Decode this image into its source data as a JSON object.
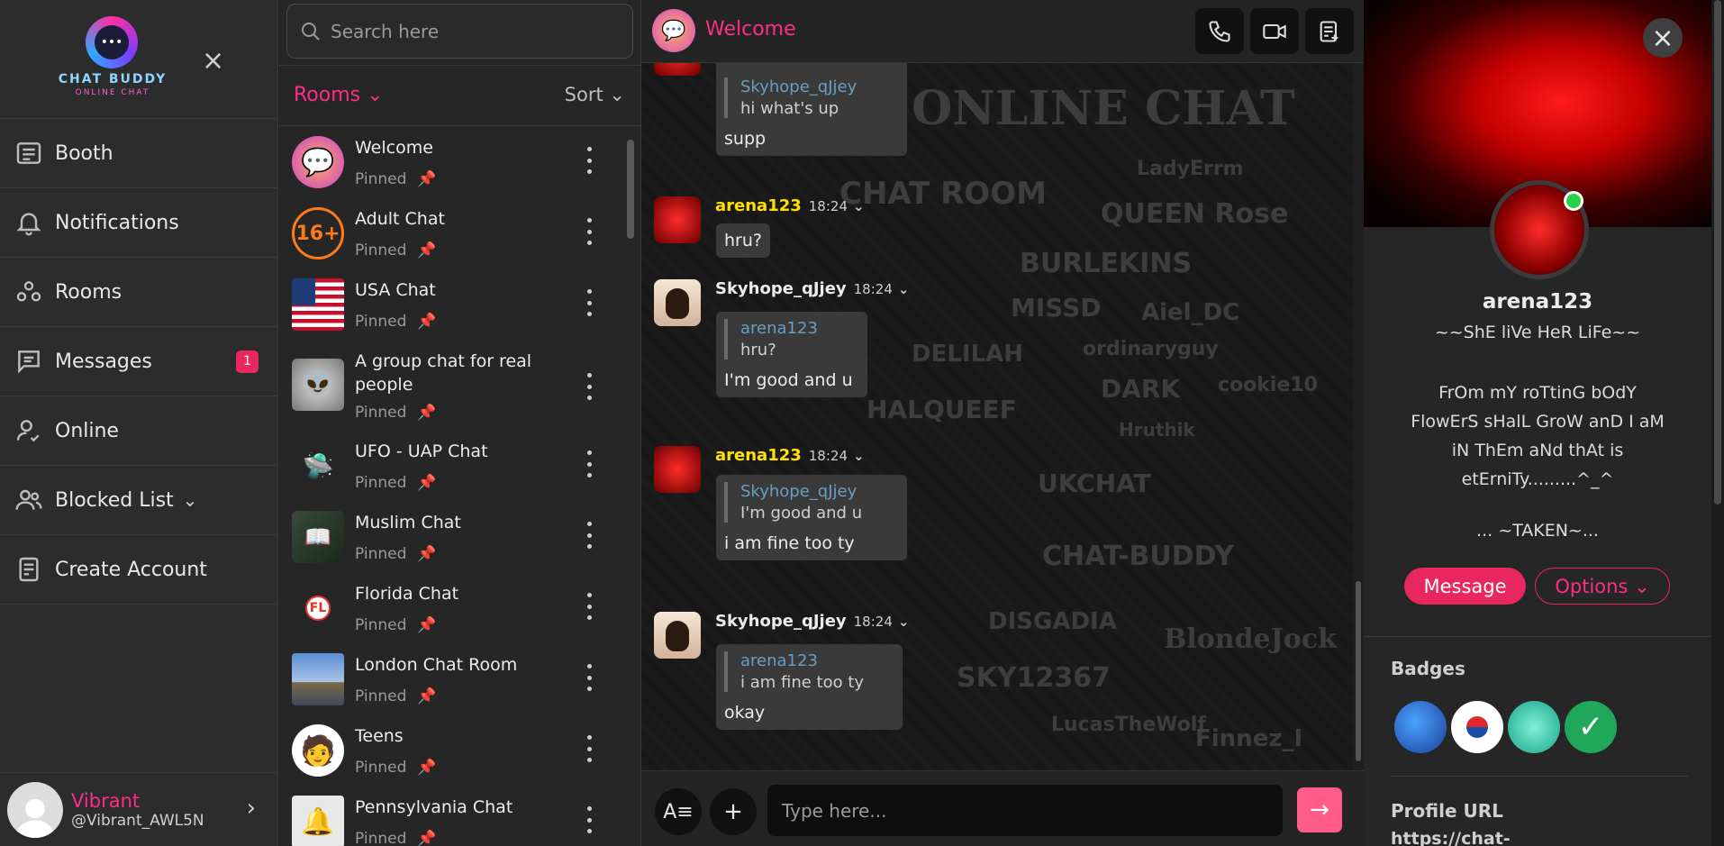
{
  "brand": {
    "title": "CHAT BUDDY",
    "subtitle": "ONLINE CHAT"
  },
  "nav": {
    "items": [
      {
        "label": "Booth",
        "icon": "booth-icon"
      },
      {
        "label": "Notifications",
        "icon": "bell-icon"
      },
      {
        "label": "Rooms",
        "icon": "rooms-icon"
      },
      {
        "label": "Messages",
        "icon": "chat-icon",
        "badge": "1"
      },
      {
        "label": "Online",
        "icon": "user-check-icon"
      },
      {
        "label": "Blocked List",
        "icon": "users-icon"
      },
      {
        "label": "Create Account",
        "icon": "form-icon"
      }
    ]
  },
  "me": {
    "name": "Vibrant",
    "handle": "@Vibrant_AWL5N"
  },
  "search": {
    "placeholder": "Search here"
  },
  "rooms": {
    "label": "Rooms",
    "sort_label": "Sort",
    "pinned_label": "Pinned",
    "list": [
      {
        "name": "Welcome",
        "icon": "welcome-chat-icon"
      },
      {
        "name": "Adult Chat",
        "icon": "16-plus-icon"
      },
      {
        "name": "USA Chat",
        "icon": "us-flag-icon"
      },
      {
        "name": "A group chat for real people",
        "icon": "alien-icon"
      },
      {
        "name": "UFO - UAP Chat",
        "icon": "ufo-icon"
      },
      {
        "name": "Muslim Chat",
        "icon": "quran-icon"
      },
      {
        "name": "Florida Chat",
        "icon": "florida-icon"
      },
      {
        "name": "London Chat Room",
        "icon": "london-icon"
      },
      {
        "name": "Teens",
        "icon": "teen-avatar-icon"
      },
      {
        "name": "Pennsylvania Chat",
        "icon": "liberty-bell-icon"
      }
    ]
  },
  "chat": {
    "title": "Welcome",
    "composer_placeholder": "Type here...",
    "messages": [
      {
        "user": "",
        "time": "",
        "quote_user": "Skyhope_qJjey",
        "quote_text": "hi what's up",
        "text": "supp"
      },
      {
        "user": "arena123",
        "time": "18:24",
        "quote_user": "",
        "quote_text": "",
        "text": "hru?"
      },
      {
        "user": "Skyhope_qJjey",
        "time": "18:24",
        "quote_user": "arena123",
        "quote_text": "hru?",
        "text": "I'm good and u"
      },
      {
        "user": "arena123",
        "time": "18:24",
        "quote_user": "Skyhope_qJjey",
        "quote_text": "I'm good and u",
        "text": "i am fine too ty"
      },
      {
        "user": "Skyhope_qJjey",
        "time": "18:24",
        "quote_user": "arena123",
        "quote_text": "i am fine too ty",
        "text": "okay"
      }
    ],
    "watermarks": [
      "ONLINE CHAT",
      "CHAT ROOM",
      "QUEEN Rose",
      "LadyErrm",
      "BURLEKINS",
      "MISSD",
      "Aiel_DC",
      "DELILAH",
      "ordinaryguy",
      "DARK",
      "cookie10",
      "HALQUEEF",
      "Hruthik",
      "UKCHAT",
      "CHAT-BUDDY",
      "SKY12367",
      "DISGADIA",
      "BlondeJock",
      "LucasTheWolf",
      "Finnez_I"
    ]
  },
  "profile": {
    "name": "arena123",
    "status": "~~ShE liVe HeR LiFe~~",
    "bio": "FrOm mY roTtinG bOdY\nFlowErS sHalL GroW anD I aM\niN ThEm aNd thAt is\netErniTy.........^_^",
    "taken": "... ~TAKEN~...",
    "message_button": "Message",
    "options_button": "Options",
    "badges_heading": "Badges",
    "url_heading": "Profile URL",
    "url_value": "https://chat-"
  },
  "colors": {
    "accent": "#ff2d87",
    "brand_pink": "#e8275f",
    "online": "#27d14b",
    "panel": "#262626"
  }
}
